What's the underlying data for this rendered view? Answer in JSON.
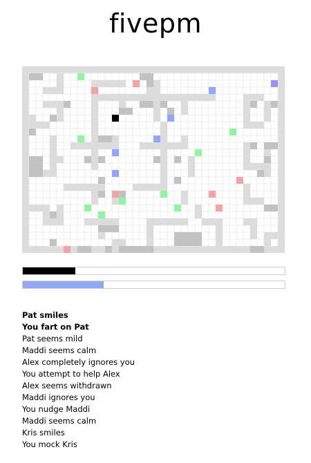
{
  "title": "fivepm",
  "colors": {
    "wall": "#dcdcdc",
    "floor": "#ffffff",
    "grid": "#ececec",
    "desk": "#c2c2c2",
    "player": "#000000",
    "green": "#90f5a0",
    "pink": "#f7a3a3",
    "blue": "#8fa8f7",
    "purple": "#9d8ff7",
    "bar_black": "#000000",
    "bar_blue": "#8fa8f7"
  },
  "bars": {
    "energy": 0.2,
    "mood": 0.31
  },
  "log": [
    {
      "text": "Pat smiles",
      "bold": true
    },
    {
      "text": "You fart on Pat",
      "bold": true
    },
    {
      "text": "Pat seems mild",
      "bold": false
    },
    {
      "text": "Maddi seems calm",
      "bold": false
    },
    {
      "text": "Alex completely ignores you",
      "bold": false
    },
    {
      "text": "You attempt to help Alex",
      "bold": false
    },
    {
      "text": "Alex seems withdrawn",
      "bold": false
    },
    {
      "text": "Maddi ignores you",
      "bold": false
    },
    {
      "text": "You nudge Maddi",
      "bold": false
    },
    {
      "text": "Maddi seems calm",
      "bold": false
    },
    {
      "text": "Kris smiles",
      "bold": false
    },
    {
      "text": "You mock Kris",
      "bold": false
    }
  ]
}
